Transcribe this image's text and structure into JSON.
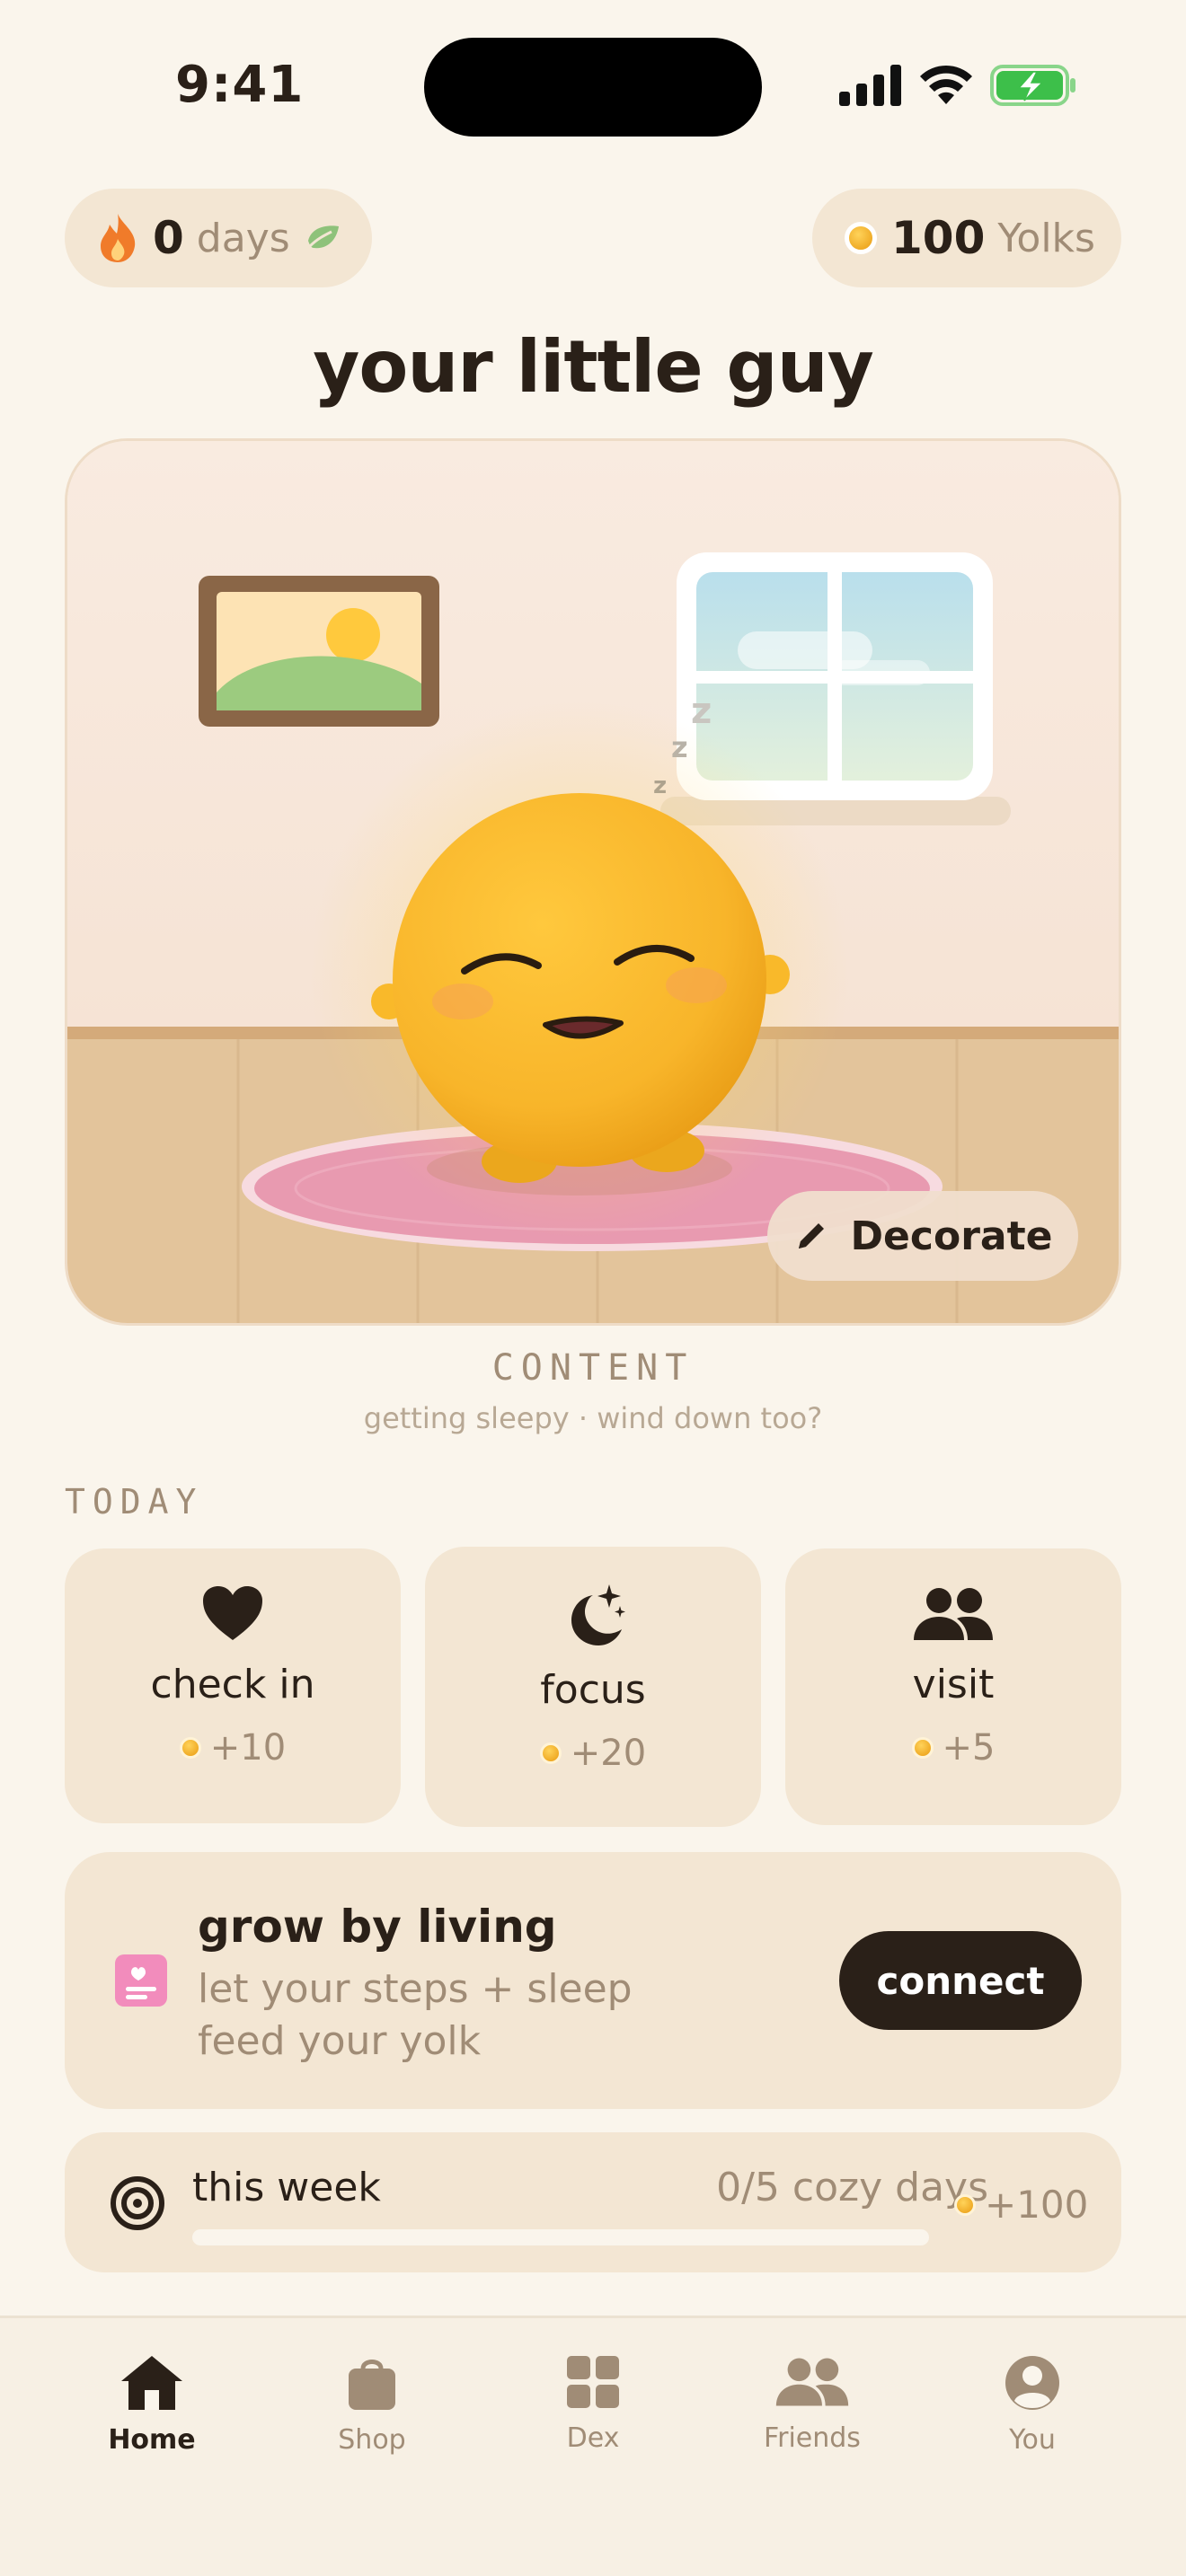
{
  "status_bar": {
    "time": "9:41"
  },
  "streak": {
    "count": "0",
    "unit": "days"
  },
  "wallet": {
    "amount": "100",
    "unit": "Yolks"
  },
  "title": "your little guy",
  "room": {
    "decorate_label": "Decorate"
  },
  "mood": {
    "label": "CONTENT",
    "subtitle": "getting sleepy · wind down too?"
  },
  "today": {
    "heading": "TODAY",
    "actions": [
      {
        "label": "check in",
        "reward": "+10",
        "icon": "heart-icon"
      },
      {
        "label": "focus",
        "reward": "+20",
        "icon": "moon-stars-icon"
      },
      {
        "label": "visit",
        "reward": "+5",
        "icon": "people-icon"
      }
    ]
  },
  "grow": {
    "title": "grow by living",
    "subtitle": "let your steps + sleep feed your yolk",
    "button": "connect"
  },
  "week": {
    "title": "this week",
    "progress_text": "0/5 cozy days",
    "progress_fraction": 0,
    "reward": "+100"
  },
  "tabs": [
    {
      "label": "Home",
      "icon": "home-icon",
      "active": true
    },
    {
      "label": "Shop",
      "icon": "bag-icon",
      "active": false
    },
    {
      "label": "Dex",
      "icon": "grid-icon",
      "active": false
    },
    {
      "label": "Friends",
      "icon": "people-icon",
      "active": false
    },
    {
      "label": "You",
      "icon": "profile-icon",
      "active": false
    }
  ],
  "colors": {
    "background": "#faf5ec",
    "card": "#f3e6d3",
    "text": "#2a2018",
    "muted": "#a08c76",
    "yolk": "#f6b321",
    "rug": "#e89ab0",
    "streak_flame": "#f07b2a",
    "battery_green": "#3dbf4a"
  }
}
